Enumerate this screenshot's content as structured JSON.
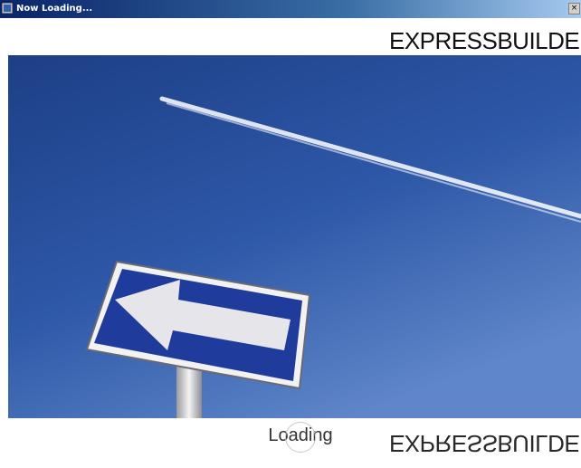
{
  "window": {
    "title": "Now Loading...",
    "close_label": "×"
  },
  "header": {
    "brand": "EXPRESSBUILDER"
  },
  "status": {
    "loading": "Loading"
  },
  "icons": {
    "app": "app-icon",
    "close": "close-icon",
    "spinner": "spinner-icon"
  },
  "colors": {
    "sky_top": "#1d3f86",
    "sky_bottom": "#5f86c8",
    "sign_blue": "#1f3c9c"
  }
}
